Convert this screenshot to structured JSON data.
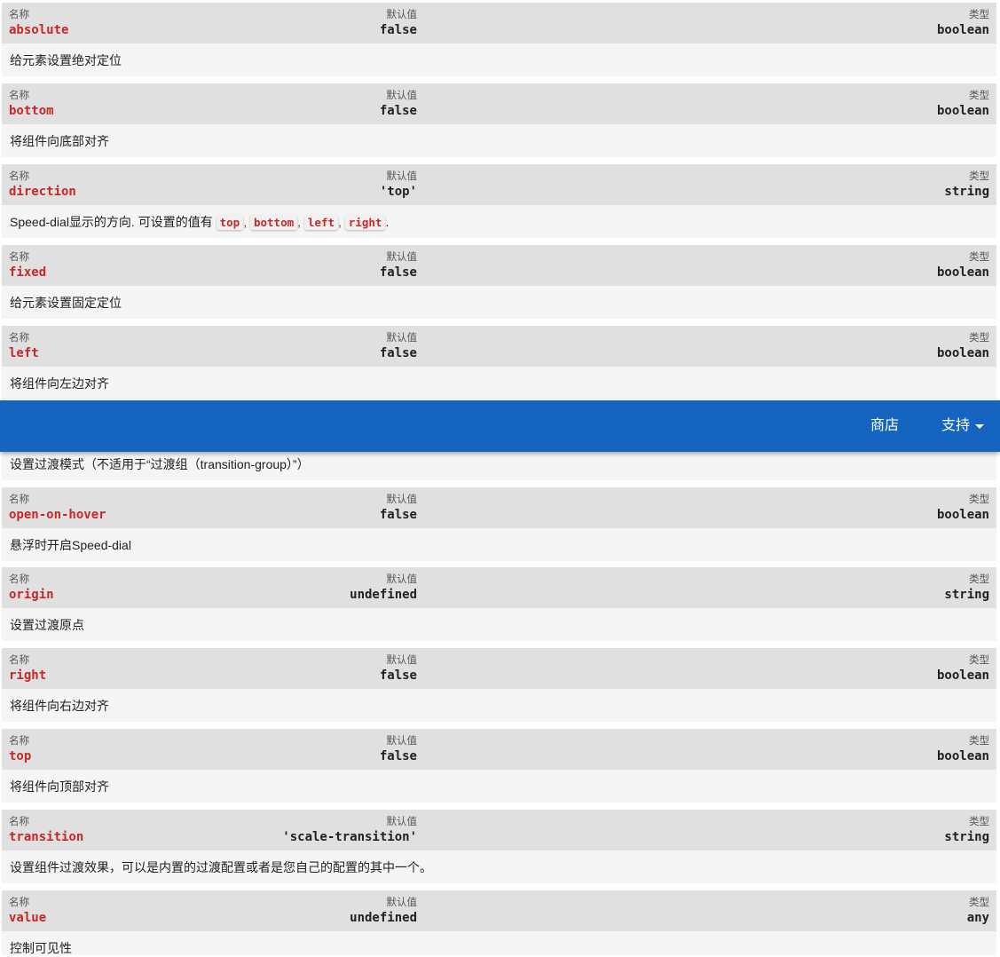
{
  "columns": {
    "name": "名称",
    "default": "默认值",
    "type": "类型"
  },
  "props": [
    {
      "name": "absolute",
      "default": "false",
      "type": "boolean",
      "desc": "给元素设置绝对定位"
    },
    {
      "name": "bottom",
      "default": "false",
      "type": "boolean",
      "desc": "将组件向底部对齐"
    },
    {
      "name": "direction",
      "default": "'top'",
      "type": "string",
      "desc_prefix": "Speed-dial显示的方向. 可设置的值有 ",
      "desc_values": [
        "top",
        "bottom",
        "left",
        "right"
      ],
      "desc_suffix": "."
    },
    {
      "name": "fixed",
      "default": "false",
      "type": "boolean",
      "desc": "给元素设置固定定位"
    },
    {
      "name": "left",
      "default": "false",
      "type": "boolean",
      "desc": "将组件向左边对齐"
    },
    {
      "desc": "设置过渡模式（不适用于“过渡组（transition-group）”）"
    },
    {
      "name": "open-on-hover",
      "default": "false",
      "type": "boolean",
      "desc": "悬浮时开启Speed-dial"
    },
    {
      "name": "origin",
      "default": "undefined",
      "type": "string",
      "desc": "设置过渡原点"
    },
    {
      "name": "right",
      "default": "false",
      "type": "boolean",
      "desc": "将组件向右边对齐"
    },
    {
      "name": "top",
      "default": "false",
      "type": "boolean",
      "desc": "将组件向顶部对齐"
    },
    {
      "name": "transition",
      "default": "'scale-transition'",
      "type": "string",
      "desc": "设置组件过渡效果，可以是内置的过渡配置或者是您自己的配置的其中一个。"
    },
    {
      "name": "value",
      "default": "undefined",
      "type": "any",
      "desc": "控制可见性"
    }
  ],
  "toolbar": {
    "store_label": "商店",
    "support_label": "支持"
  }
}
